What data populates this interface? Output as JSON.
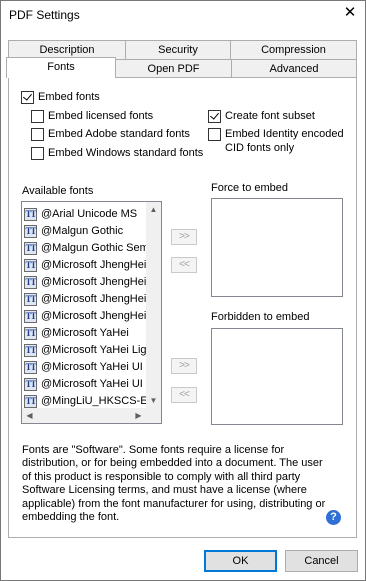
{
  "window": {
    "title": "PDF Settings",
    "close_glyph": "✕"
  },
  "tabs": {
    "row1": [
      "Description",
      "Security",
      "Compression"
    ],
    "row2": [
      "Fonts",
      "Open PDF",
      "Advanced"
    ],
    "active": "Fonts"
  },
  "fonts": {
    "embed_fonts": {
      "label": "Embed fonts",
      "checked": true
    },
    "embed_licensed": {
      "label": "Embed licensed fonts",
      "checked": false
    },
    "embed_adobe": {
      "label": "Embed Adobe standard fonts",
      "checked": false
    },
    "embed_windows": {
      "label": "Embed Windows standard fonts",
      "checked": false
    },
    "create_subset": {
      "label": "Create font subset",
      "checked": true
    },
    "embed_identity": {
      "label": "Embed Identity encoded CID fonts only",
      "line1": "Embed Identity encoded",
      "line2": "CID fonts only",
      "checked": false
    },
    "available_label": "Available fonts",
    "force_label": "Force to embed",
    "forbidden_label": "Forbidden to embed",
    "available_fonts": [
      "@Arial Unicode MS",
      "@Malgun Gothic",
      "@Malgun Gothic Semilight",
      "@Microsoft JhengHei",
      "@Microsoft JhengHei",
      "@Microsoft JhengHei",
      "@Microsoft JhengHei",
      "@Microsoft YaHei",
      "@Microsoft YaHei Light",
      "@Microsoft YaHei UI",
      "@Microsoft YaHei UI",
      "@MingLiU_HKSCS-ExtB"
    ],
    "add_glyph": ">>",
    "remove_glyph": "<<",
    "truetype_icon_text": "TT",
    "notice": "Fonts are \"Software\". Some fonts require a license for distribution, or for being embedded into a document. The user of this product is responsible to comply with all third party Software Licensing terms, and must have a license (where applicable) from the font manufacturer for using, distributing or embedding the font."
  },
  "buttons": {
    "ok": "OK",
    "cancel": "Cancel",
    "help_glyph": "?"
  },
  "colors": {
    "help_blue": "#2f6fd6",
    "default_border": "#0078d7"
  }
}
